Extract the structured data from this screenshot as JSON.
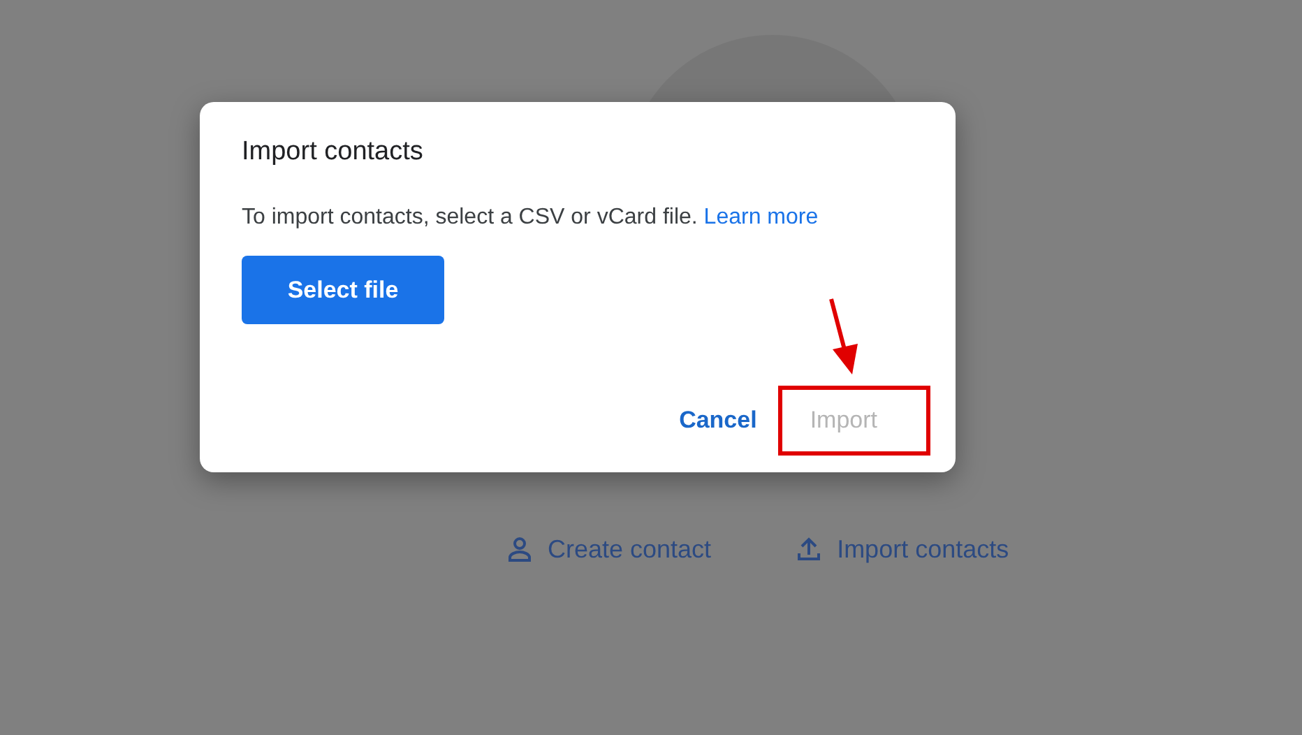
{
  "page": {
    "actions": [
      {
        "label": "Create contact",
        "kind": "person"
      },
      {
        "label": "Import contacts",
        "kind": "upload"
      }
    ]
  },
  "dialog": {
    "title": "Import contacts",
    "message": "To import contacts, select a CSV or vCard file.",
    "link": "Learn more",
    "select_button": "Select file",
    "buttons": [
      {
        "label": "Cancel",
        "disabled": false
      },
      {
        "label": "Import",
        "disabled": true
      }
    ]
  }
}
